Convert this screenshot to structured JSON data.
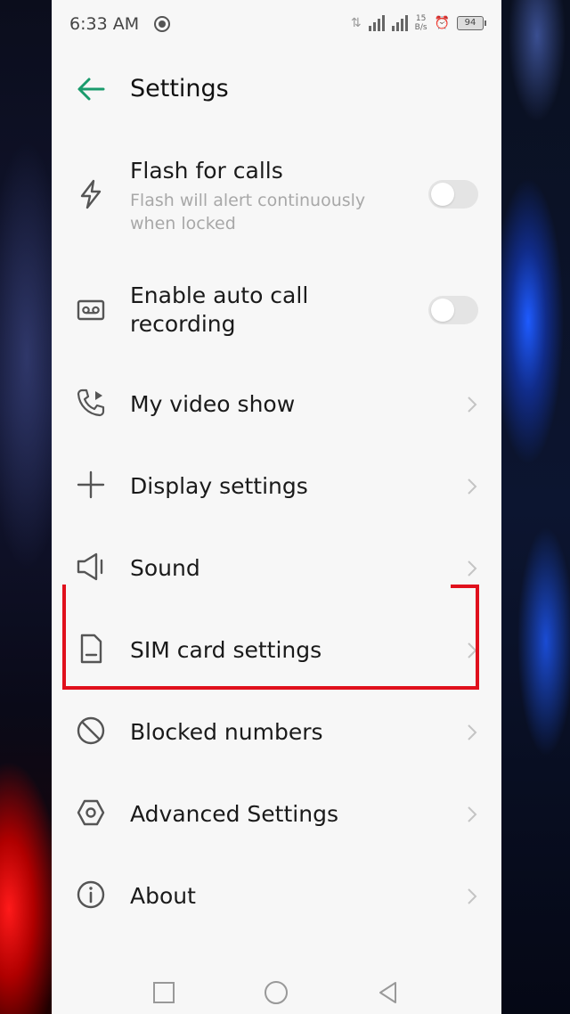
{
  "status_bar": {
    "time": "6:33 AM",
    "net_speed_value": "15",
    "net_speed_unit": "B/s",
    "battery": "94"
  },
  "header": {
    "title": "Settings",
    "back_icon": "arrow-left-icon"
  },
  "items": [
    {
      "label": "Flash for calls",
      "sub": "Flash will alert continuously when locked",
      "icon": "flash-icon",
      "control": "toggle",
      "toggle_on": false
    },
    {
      "label": "Enable auto call recording",
      "icon": "recording-icon",
      "control": "toggle",
      "toggle_on": false
    },
    {
      "label": "My video show",
      "icon": "video-call-icon",
      "control": "chevron"
    },
    {
      "label": "Display settings",
      "icon": "plus-icon",
      "control": "chevron"
    },
    {
      "label": "Sound",
      "icon": "speaker-icon",
      "control": "chevron"
    },
    {
      "label": "SIM card settings",
      "icon": "sim-card-icon",
      "control": "chevron",
      "highlighted": true
    },
    {
      "label": "Blocked numbers",
      "icon": "block-icon",
      "control": "chevron"
    },
    {
      "label": "Advanced Settings",
      "icon": "hexagon-settings-icon",
      "control": "chevron"
    },
    {
      "label": "About",
      "icon": "info-icon",
      "control": "chevron"
    }
  ],
  "colors": {
    "accent": "#1a9b6c",
    "highlight": "#e0101c",
    "background": "#f7f7f7"
  }
}
